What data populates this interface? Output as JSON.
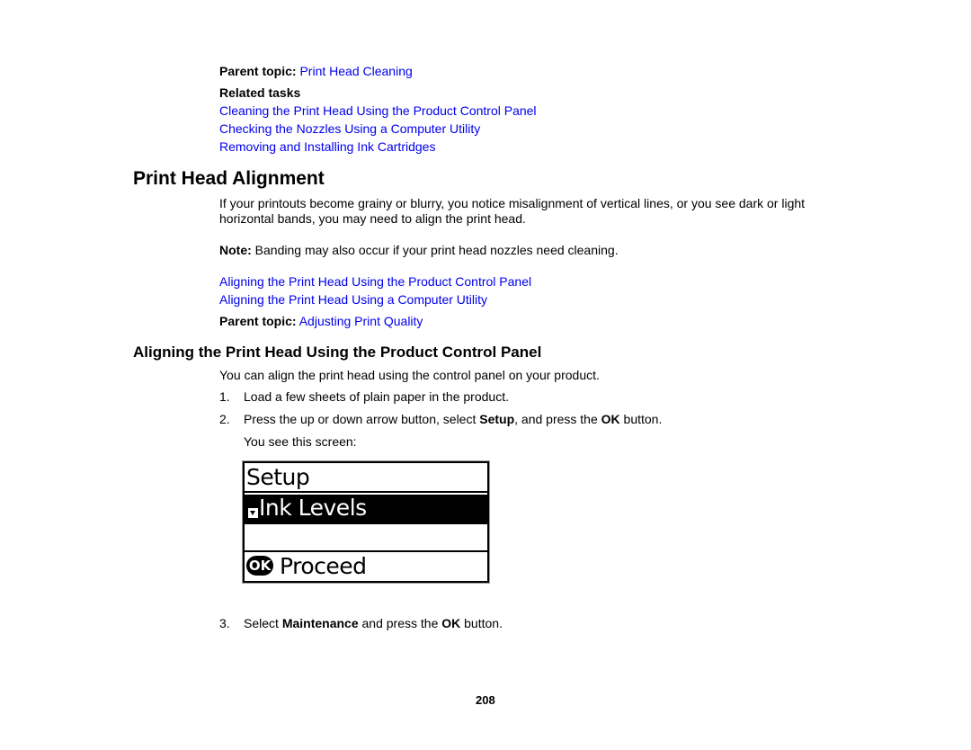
{
  "top_section": {
    "parent_topic_label": "Parent topic:",
    "parent_topic_link": "Print Head Cleaning",
    "related_tasks_heading": "Related tasks",
    "related_links": [
      "Cleaning the Print Head Using the Product Control Panel",
      "Checking the Nozzles Using a Computer Utility",
      "Removing and Installing Ink Cartridges"
    ]
  },
  "alignment_section": {
    "title": "Print Head Alignment",
    "intro": "If your printouts become grainy or blurry, you notice misalignment of vertical lines, or you see dark or light horizontal bands, you may need to align the print head.",
    "note_label": "Note:",
    "note_text": " Banding may also occur if your print head nozzles need cleaning.",
    "links": [
      "Aligning the Print Head Using the Product Control Panel",
      "Aligning the Print Head Using a Computer Utility"
    ],
    "parent_topic_label": "Parent topic:",
    "parent_topic_link": "Adjusting Print Quality"
  },
  "control_panel_section": {
    "title": "Aligning the Print Head Using the Product Control Panel",
    "intro": "You can align the print head using the control panel on your product.",
    "steps": [
      {
        "number": "1.",
        "text": "Load a few sheets of plain paper in the product."
      },
      {
        "number": "2.",
        "pre": "Press the up or down arrow button, select ",
        "bold1": "Setup",
        "mid": ", and press the ",
        "bold2": "OK",
        "post": " button.",
        "followup": "You see this screen:"
      },
      {
        "number": "3.",
        "pre": "Select ",
        "bold1": "Maintenance",
        "mid": " and press the ",
        "bold2": "OK",
        "post": " button."
      }
    ]
  },
  "lcd_screen": {
    "title": "Setup",
    "selected_item": "Ink Levels",
    "selected_icon": "down-arrow-icon",
    "blank_row": "",
    "ok_badge": "OK",
    "action_label": "Proceed"
  },
  "footer": {
    "page_number": "208"
  }
}
